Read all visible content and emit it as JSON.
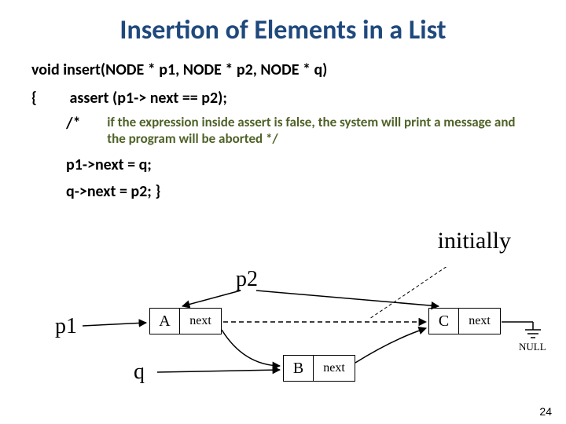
{
  "title": "Insertion of Elements in a List",
  "signature": "void insert(NODE *  p1, NODE * p2, NODE * q)",
  "brace_open": "{",
  "assert_line": "assert (p1-> next == p2);",
  "comment_star": "/*",
  "comment_text": "if the expression inside assert is false, the system will print a message and the program will be aborted   */",
  "stmt1": "p1->next = q;",
  "stmt2": "q->next = p2;  }",
  "initially": "initially",
  "labels": {
    "p1": "p1",
    "p2": "p2",
    "q": "q",
    "null": "NULL"
  },
  "nodes": {
    "A": {
      "letter": "A",
      "next": "next"
    },
    "B": {
      "letter": "B",
      "next": "next"
    },
    "C": {
      "letter": "C",
      "next": "next"
    }
  },
  "page_number": "24"
}
